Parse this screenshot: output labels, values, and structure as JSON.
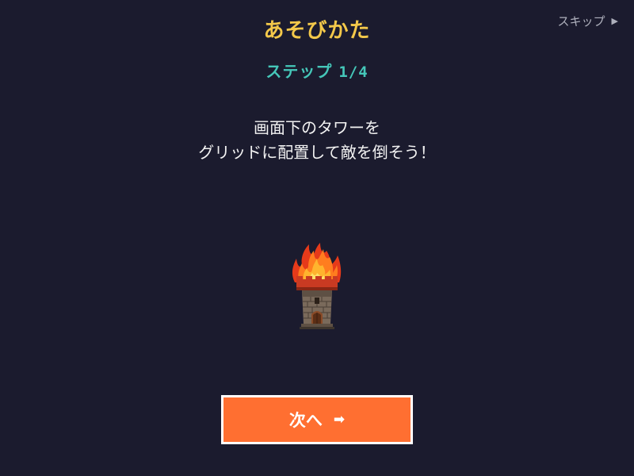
{
  "header": {
    "title": "あそびかた",
    "step_label": "ステップ",
    "step_progress": "1/4"
  },
  "skip": {
    "label": "スキップ",
    "icon": "play-triangle-icon"
  },
  "instructions": {
    "line1": "画面下のタワーを",
    "line2": "グリッドに配置して敵を倒そう！"
  },
  "illustration": {
    "icon": "fire-tower-icon"
  },
  "next_button": {
    "label": "次へ",
    "icon": "right-arrow-icon"
  },
  "colors": {
    "background": "#1b1b2e",
    "title": "#f3c84a",
    "step": "#45c7b9",
    "button": "#ff6f31"
  }
}
